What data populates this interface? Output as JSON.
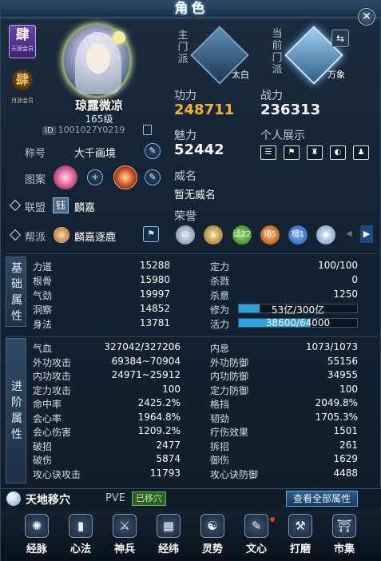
{
  "window": {
    "title": "角色",
    "close": "✕"
  },
  "badges": {
    "top_char": "肆",
    "top_sub": "天涯会员",
    "bottom_char": "肆",
    "bottom_sub": "月涯会员"
  },
  "character": {
    "name": "琼露微凉",
    "level": "165级",
    "id_tag": "ID",
    "id": "1001027Y0219"
  },
  "title_row": {
    "label": "称号",
    "value": "大千画境"
  },
  "pattern_row": {
    "label": "图案",
    "add": "+"
  },
  "alliance_row": {
    "label": "联盟",
    "tag": "钰",
    "value": "麟嘉"
  },
  "guild_row": {
    "label": "帮派",
    "value": "麟嘉逐鹿",
    "flag": "⚑"
  },
  "sect": {
    "main_label": "主门派",
    "main_name": "太白",
    "current_label": "当前门派",
    "current_name": "万象",
    "swap": "⇆"
  },
  "stats": {
    "gongli_label": "功力",
    "gongli": "248711",
    "zhanli_label": "战力",
    "zhanli": "236313",
    "meili_label": "魅力",
    "meili": "52442",
    "showcase_label": "个人展示",
    "showcase_icons": [
      "☰",
      "⚑",
      "♜",
      "◐",
      "♟"
    ]
  },
  "fame": {
    "label": "威名",
    "value": "暂无威名"
  },
  "honor": {
    "label": "荣誉",
    "icons": [
      "☖",
      "⚔",
      "迳22",
      "师5",
      "榜1",
      "◆"
    ],
    "prev": "◀",
    "next": "▶"
  },
  "basic": {
    "tab": [
      "基",
      "础",
      "属",
      "性"
    ],
    "left": [
      {
        "name": "力道",
        "value": "15288"
      },
      {
        "name": "根骨",
        "value": "15980"
      },
      {
        "name": "气劲",
        "value": "19997"
      },
      {
        "name": "洞察",
        "value": "14852"
      },
      {
        "name": "身法",
        "value": "13781"
      }
    ],
    "right": [
      {
        "name": "定力",
        "value": "100/100"
      },
      {
        "name": "杀戮",
        "value": "0"
      },
      {
        "name": "杀意",
        "value": "1250"
      }
    ],
    "xiuwei": {
      "name": "修为",
      "text": "53亿/300亿",
      "fraction": 0.177
    },
    "huoli": {
      "name": "活力",
      "text": "38600/64000",
      "fraction": 0.603
    }
  },
  "advanced": {
    "tab": [
      "进",
      "阶",
      "属",
      "性"
    ],
    "left": [
      {
        "name": "气血",
        "value": "327042/327206"
      },
      {
        "name": "外功攻击",
        "value": "69384~70904"
      },
      {
        "name": "内功攻击",
        "value": "24971~25912"
      },
      {
        "name": "定力攻击",
        "value": "100"
      },
      {
        "name": "命中率",
        "value": "2425.2%"
      },
      {
        "name": "会心率",
        "value": "1964.8%"
      },
      {
        "name": "会心伤害",
        "value": "1209.2%"
      },
      {
        "name": "破招",
        "value": "2477"
      },
      {
        "name": "破伤",
        "value": "5874"
      },
      {
        "name": "攻心诀攻击",
        "value": "11793"
      }
    ],
    "right": [
      {
        "name": "内息",
        "value": "1073/1073"
      },
      {
        "name": "外功防御",
        "value": "55156"
      },
      {
        "name": "内功防御",
        "value": "34955"
      },
      {
        "name": "定力防御",
        "value": "100"
      },
      {
        "name": "格挡",
        "value": "2049.8%"
      },
      {
        "name": "韧劲",
        "value": "1705.3%"
      },
      {
        "name": "疗伤效果",
        "value": "1501"
      },
      {
        "name": "拆招",
        "value": "261"
      },
      {
        "name": "御伤",
        "value": "1629"
      },
      {
        "name": "攻心诀防御",
        "value": "4488"
      }
    ]
  },
  "mode": {
    "name": "天地移穴",
    "pve": "PVE",
    "badge": "已移穴",
    "all_attr": "查看全部属性"
  },
  "nav": [
    {
      "label": "经脉",
      "icon": "✺"
    },
    {
      "label": "心法",
      "icon": "▮"
    },
    {
      "label": "神兵",
      "icon": "⚔"
    },
    {
      "label": "经纬",
      "icon": "▦"
    },
    {
      "label": "灵势",
      "icon": "☯"
    },
    {
      "label": "文心",
      "icon": "✎"
    },
    {
      "label": "打磨",
      "icon": "⚒"
    },
    {
      "label": "市集",
      "icon": "⛩"
    }
  ],
  "colors": {
    "gold": "#f2b233",
    "bar": "#2ba4e0",
    "accent": "#6fa4d2"
  }
}
